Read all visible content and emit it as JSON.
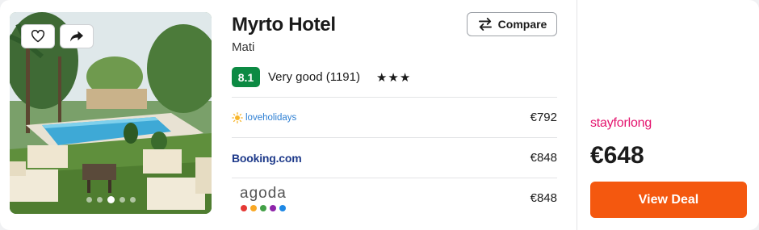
{
  "hotel": {
    "name": "Myrto Hotel",
    "location": "Mati",
    "score": "8.1",
    "rating_text": "Very good (1191)",
    "stars": "★★★",
    "star_count": 3
  },
  "compare": {
    "label": "Compare",
    "icon": "swap-arrows-icon"
  },
  "photo": {
    "favorite_icon": "heart-icon",
    "share_icon": "share-arrow-icon",
    "slide_count": 5,
    "active_slide": 3
  },
  "offers": [
    {
      "provider": "loveholidays",
      "price": "€792"
    },
    {
      "provider": "Booking.com",
      "price": "€848"
    },
    {
      "provider": "agoda",
      "price": "€848"
    }
  ],
  "deal": {
    "provider": "stayforlong",
    "price": "€648",
    "button_label": "View Deal"
  },
  "colors": {
    "score_badge": "#0c8a43",
    "cta": "#f4580f",
    "stayforlong": "#e4146e",
    "booking": "#1e3a8a",
    "loveholidays": "#2d7fd3",
    "agoda_dots": [
      "#e53935",
      "#f9a825",
      "#43a047",
      "#8e24aa",
      "#1e88e5"
    ]
  }
}
